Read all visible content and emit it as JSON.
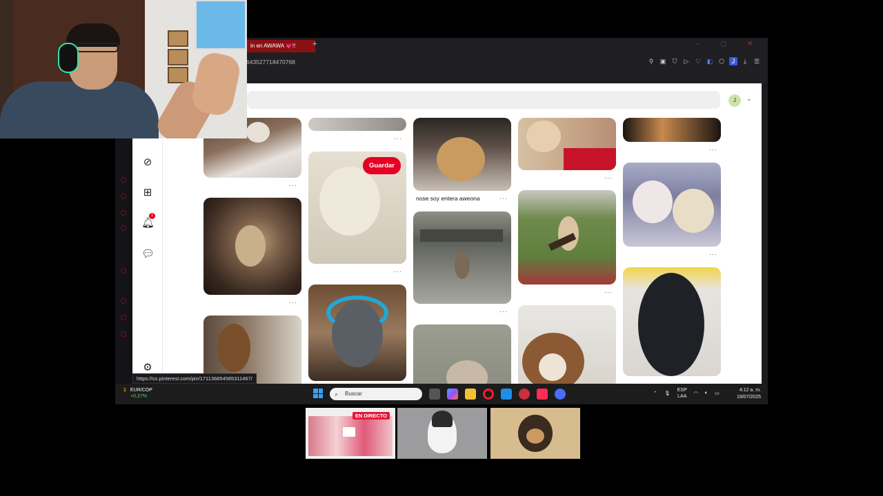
{
  "browser": {
    "tab_title": "in en AWAWA 💗!!",
    "new_tab": "+",
    "url": "64352771847076​8",
    "window_controls": "– ▢ ✕",
    "toolbar_icons": [
      "pin-icon",
      "snapshot-icon",
      "shield-icon",
      "play-icon",
      "heart-icon",
      "translate-icon",
      "extensions-icon",
      "profile-icon",
      "download-icon",
      "menu-icon"
    ],
    "profile_letter": "J",
    "status_url": "https://co.pinterest.com/pin/171136854585311467/"
  },
  "pinterest": {
    "avatar_letter": "J",
    "save_label": "Guardar",
    "pin_caption": "nose soy entera aweona",
    "notification_count": "1",
    "more": "···"
  },
  "taskbar": {
    "ticker_name": "EUR/COP",
    "ticker_change": "+0,37%",
    "ticker_badge": "1",
    "search_placeholder": "Buscar",
    "lang_line1": "ESP",
    "lang_line2": "LAA",
    "time": "4:12 a. m.",
    "date": "19/07/2025"
  },
  "stream": {
    "live_label": "EN DIRECTO"
  },
  "colors": {
    "pinterest_red": "#e60023",
    "opera_red": "#8b1014",
    "taskbar": "#1c1c1c"
  }
}
